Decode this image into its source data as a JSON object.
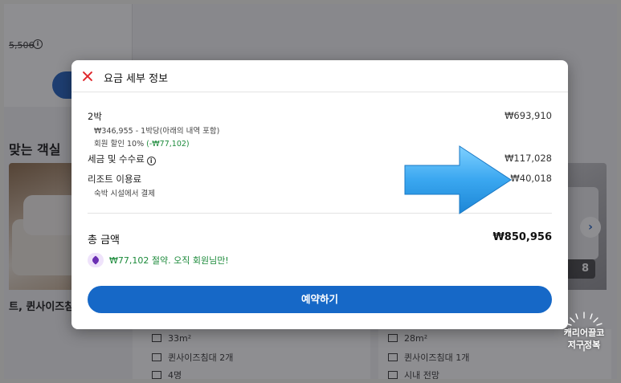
{
  "background": {
    "strike_price": "5,506",
    "section_heading": "맞는 객실",
    "room_left_name": "트, 퀸사이즈침",
    "photo_count": "8",
    "left_column": {
      "area": "33m²",
      "bed": "퀸사이즈침대 2개",
      "guests": "4명"
    },
    "right_column": {
      "area": "28m²",
      "bed": "퀸사이즈침대 1개",
      "view": "시내 전망"
    },
    "next_arrow": "›"
  },
  "modal": {
    "title": "요금 세부 정보",
    "nights": {
      "label": "2박",
      "amount": "₩693,910",
      "per_night": "₩346,955 - 1박당(아래의 내역 포함)",
      "discount_prefix": "회원 할인 10% ",
      "discount_amount": "(-₩77,102)"
    },
    "taxes": {
      "label": "세금 및 수수료",
      "amount": "₩117,028"
    },
    "resort_fee": {
      "label": "리조트 이용료",
      "amount": "₩40,018",
      "note": "숙박 시설에서 결제"
    },
    "total": {
      "label": "총 금액",
      "amount": "₩850,956"
    },
    "savings": "₩77,102 절약. 오직 회원님만!",
    "book_button": "예약하기"
  },
  "watermark": {
    "line1": "캐리어끌고",
    "line2": "지구정복"
  },
  "colors": {
    "accent_blue": "#1668c7",
    "close_red": "#e0282c",
    "savings_green": "#1b8a3a",
    "arrow_blue": "#3aa7f0",
    "tag_purple": "#6b2fb3"
  }
}
